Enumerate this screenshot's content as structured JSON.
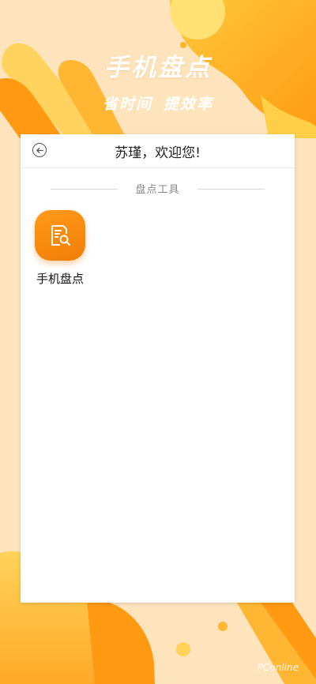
{
  "hero": {
    "title": "手机盘点",
    "subtitle_a": "省时间",
    "subtitle_b": "提效率"
  },
  "card": {
    "header_title": "苏瑾，欢迎您!",
    "back_icon": "back-arrow-icon",
    "section_label": "盘点工具",
    "tools": [
      {
        "label": "手机盘点",
        "icon": "inventory-document-search-icon"
      }
    ]
  },
  "watermark": "PConline",
  "colors": {
    "background": "#fde2b6",
    "accent_orange": "#f07d06",
    "accent_yellow": "#ffd23f"
  }
}
